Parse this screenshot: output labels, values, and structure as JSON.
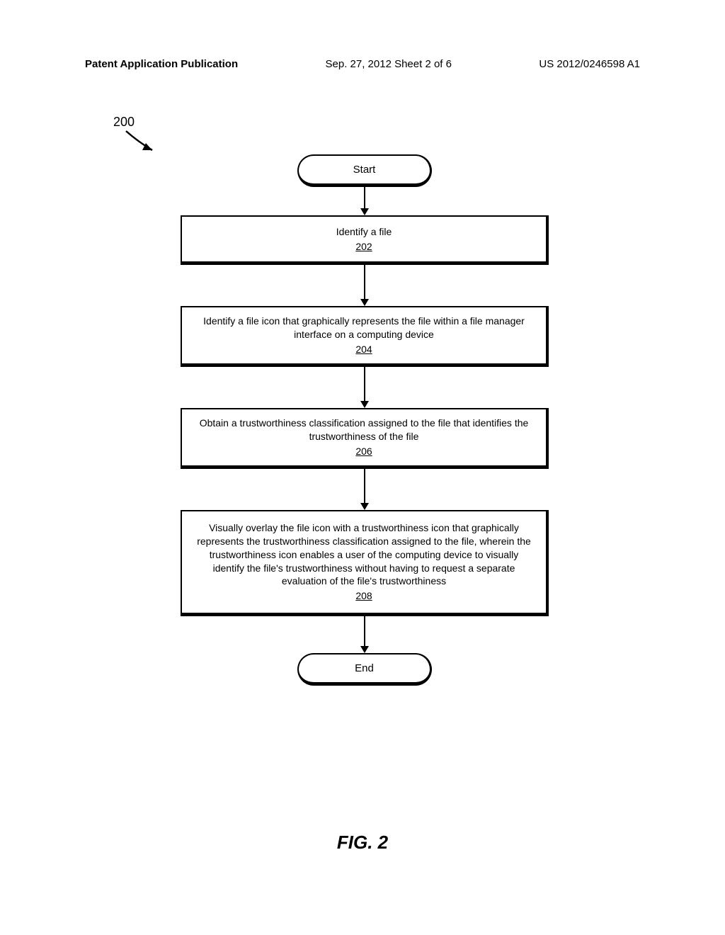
{
  "header": {
    "left": "Patent Application Publication",
    "center": "Sep. 27, 2012  Sheet 2 of 6",
    "right": "US 2012/0246598 A1"
  },
  "reference_number": "200",
  "flowchart": {
    "start": "Start",
    "steps": [
      {
        "text": "Identify a file",
        "num": "202"
      },
      {
        "text": "Identify a file icon that graphically represents the file within a file manager interface on a computing device",
        "num": "204"
      },
      {
        "text": "Obtain a trustworthiness classification assigned to the file that identifies the trustworthiness of the file",
        "num": "206"
      },
      {
        "text": "Visually overlay the file icon with a trustworthiness icon that graphically represents the trustworthiness classification assigned to the file, wherein the trustworthiness icon enables a user of the computing device to visually identify the file's trustworthiness without having to request a separate evaluation of the file's trustworthiness",
        "num": "208"
      }
    ],
    "end": "End"
  },
  "figure_label": "FIG. 2",
  "chart_data": {
    "type": "flowchart",
    "title": "FIG. 2",
    "reference": "200",
    "nodes": [
      {
        "id": "start",
        "type": "terminator",
        "label": "Start"
      },
      {
        "id": "202",
        "type": "process",
        "label": "Identify a file"
      },
      {
        "id": "204",
        "type": "process",
        "label": "Identify a file icon that graphically represents the file within a file manager interface on a computing device"
      },
      {
        "id": "206",
        "type": "process",
        "label": "Obtain a trustworthiness classification assigned to the file that identifies the trustworthiness of the file"
      },
      {
        "id": "208",
        "type": "process",
        "label": "Visually overlay the file icon with a trustworthiness icon that graphically represents the trustworthiness classification assigned to the file, wherein the trustworthiness icon enables a user of the computing device to visually identify the file's trustworthiness without having to request a separate evaluation of the file's trustworthiness"
      },
      {
        "id": "end",
        "type": "terminator",
        "label": "End"
      }
    ],
    "edges": [
      {
        "from": "start",
        "to": "202"
      },
      {
        "from": "202",
        "to": "204"
      },
      {
        "from": "204",
        "to": "206"
      },
      {
        "from": "206",
        "to": "208"
      },
      {
        "from": "208",
        "to": "end"
      }
    ]
  }
}
